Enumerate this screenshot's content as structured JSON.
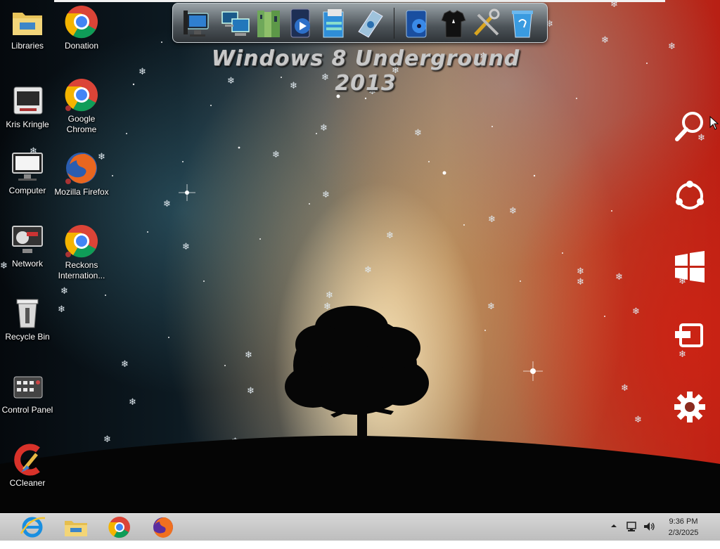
{
  "desktop": {
    "brand_text": "Windows 8 Underground 2013",
    "icons": [
      {
        "label": "Libraries"
      },
      {
        "label": "Donation"
      },
      {
        "label": "Kris Kringle"
      },
      {
        "label": "Google Chrome"
      },
      {
        "label": "Computer"
      },
      {
        "label": "Mozilla Firefox"
      },
      {
        "label": "Network"
      },
      {
        "label": "Reckons Internation..."
      },
      {
        "label": "Recycle Bin"
      },
      {
        "label": "Control Panel"
      },
      {
        "label": "CCleaner"
      }
    ]
  },
  "dock": {
    "items": [
      "computer-icon",
      "network-computers-icon",
      "library-books-icon",
      "media-player-icon",
      "file-folder-icon",
      "disk-drive-icon",
      "music-player-icon",
      "tshirt-icon",
      "tools-icon",
      "recycle-bin-icon"
    ]
  },
  "charms": [
    "search-icon",
    "share-icon",
    "windows-start-icon",
    "devices-icon",
    "settings-gear-icon"
  ],
  "taskbar": {
    "pinned": [
      "internet-explorer-icon",
      "file-explorer-icon",
      "chrome-icon",
      "firefox-icon"
    ],
    "clock_time": "9:36 PM",
    "clock_date": "2/3/2025"
  },
  "colors": {
    "taskbar": "#c8c8c8",
    "sky_left": "#0d1a22",
    "sky_right": "#b81f14"
  }
}
